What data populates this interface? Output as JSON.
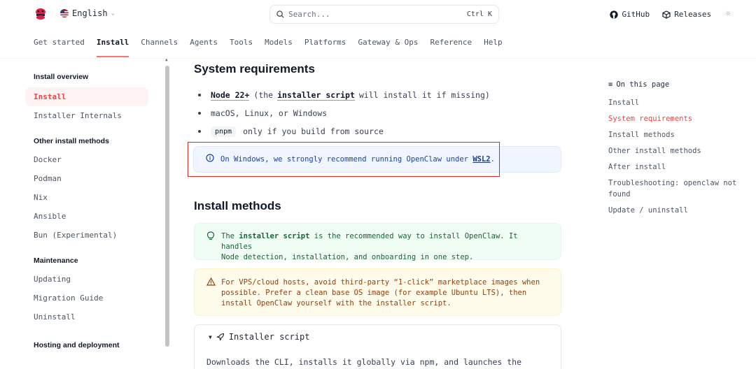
{
  "header": {
    "language": "English",
    "search_placeholder": "Search...",
    "search_shortcut": "Ctrl K",
    "github_label": "GitHub",
    "releases_label": "Releases"
  },
  "nav": {
    "tabs": [
      "Get started",
      "Install",
      "Channels",
      "Agents",
      "Tools",
      "Models",
      "Platforms",
      "Gateway & Ops",
      "Reference",
      "Help"
    ],
    "active_tab": "Install"
  },
  "sidebar": {
    "groups": [
      {
        "title": "Install overview",
        "items": [
          "Install",
          "Installer Internals"
        ]
      },
      {
        "title": "Other install methods",
        "items": [
          "Docker",
          "Podman",
          "Nix",
          "Ansible",
          "Bun (Experimental)"
        ]
      },
      {
        "title": "Maintenance",
        "items": [
          "Updating",
          "Migration Guide",
          "Uninstall"
        ]
      },
      {
        "title": "Hosting and deployment",
        "items": []
      }
    ],
    "active_item": "Install"
  },
  "main": {
    "system_requirements": {
      "heading": "System requirements",
      "bullet1_link": "Node 22+",
      "bullet1_pre": "(the",
      "bullet1_link2": "installer script",
      "bullet1_post": "will install it if missing)",
      "bullet2": "macOS, Linux, or Windows",
      "bullet3_code": "pnpm",
      "bullet3_text": "only if you build from source",
      "info_text": "On Windows, we strongly recommend running OpenClaw under",
      "info_link": "WSL2",
      "info_end": "."
    },
    "install_methods": {
      "heading": "Install methods",
      "tip_pre": "The",
      "tip_bold": "installer script",
      "tip_line1": "is the recommended way to install OpenClaw. It handles",
      "tip_line2": "Node detection, installation, and onboarding in one step.",
      "warn_line1": "For VPS/cloud hosts, avoid third-party “1-click” marketplace images when",
      "warn_line2": "possible. Prefer a clean base OS image (for example Ubuntu LTS), then",
      "warn_line3": "install OpenClaw yourself with the installer script.",
      "details_summary": "Installer script",
      "details_body": "Downloads the CLI, installs it globally via npm, and launches the"
    }
  },
  "toc": {
    "title": "On this page",
    "items": [
      "Install",
      "System requirements",
      "Install methods",
      "Other install methods",
      "After install",
      "Troubleshooting: openclaw not found",
      "Update / uninstall"
    ],
    "active": "System requirements"
  },
  "colors": {
    "accent": "#ef4444",
    "info_bg": "#eff6ff",
    "tip_bg": "#f0fdf4",
    "warn_bg": "#fffbeb",
    "highlight_box": "#dc2626"
  }
}
